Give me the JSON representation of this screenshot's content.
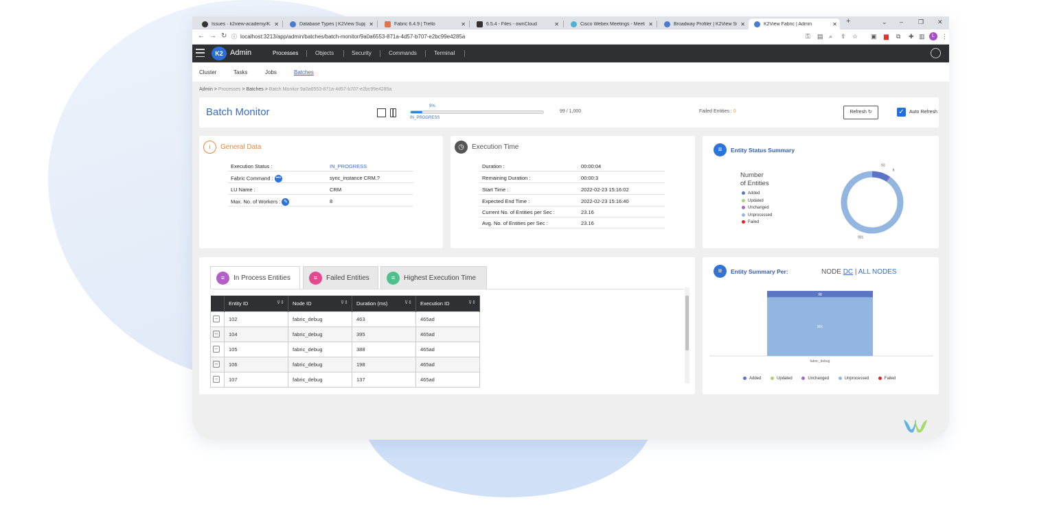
{
  "browser": {
    "tabs": [
      {
        "label": "Issues · k2view-academy/K2View"
      },
      {
        "label": "Database Types | K2View Supp"
      },
      {
        "label": "Fabric 6.4.9 | Trello"
      },
      {
        "label": "6.5.4 - Files - ownCloud"
      },
      {
        "label": "Cisco Webex Meetings - Meetin"
      },
      {
        "label": "Broadway Profiler | K2View Supp"
      },
      {
        "label": "K2View Fabric | Admin"
      }
    ],
    "new_tab": "+",
    "url": "localhost:3213/app/admin/batches/batch-monitor/9a0a6553-871a-4d57-b707-e2bc99e4285a"
  },
  "topnav": {
    "logo": "K2",
    "app": "Admin",
    "items": [
      "Processes",
      "Objects",
      "Security",
      "Commands",
      "Terminal"
    ]
  },
  "subnav": [
    "Cluster",
    "Tasks",
    "Jobs",
    "Batches"
  ],
  "breadcrumb": {
    "items": [
      "Admin",
      "Processes",
      "Batches"
    ],
    "current": "Batch Monitor 9a0a6553-871a-4d57-b707-e2bc99e4285a"
  },
  "header": {
    "title": "Batch Monitor",
    "progress_pct": "9%",
    "progress_fraction": 0.09,
    "progress_count": "99 / 1,000",
    "progress_status": "IN_PROGRESS",
    "failed_label": "Failed Entities :",
    "failed_value": "0",
    "refresh": "Refresh ↻",
    "auto_refresh": "Auto Refresh"
  },
  "general": {
    "title": "General Data",
    "rows": [
      {
        "k": "Execution Status :",
        "v": "IN_PROGRESS"
      },
      {
        "k": "Fabric Command :",
        "v": "sync_instance CRM.?"
      },
      {
        "k": "LU Name :",
        "v": "CRM"
      },
      {
        "k": "Max. No. of Workers :",
        "v": "8"
      }
    ]
  },
  "execution": {
    "title": "Execution Time",
    "rows": [
      {
        "k": "Duration :",
        "v": "00:00:04"
      },
      {
        "k": "Remaining Duration :",
        "v": "00:00:3"
      },
      {
        "k": "Start Time :",
        "v": "2022-02-23 15:16:02"
      },
      {
        "k": "Expected End Time :",
        "v": "2022-02-23 15:16:40"
      },
      {
        "k": "Current No. of Entities per Sec :",
        "v": "23.16"
      },
      {
        "k": "Avg. No. of Entities per Sec :",
        "v": "23.16"
      }
    ]
  },
  "status_summary": {
    "title": "Entity Status Summary",
    "chart_title_1": "Number",
    "chart_title_2": "of Entities",
    "legend": [
      {
        "label": "Added",
        "color": "#5b74c4"
      },
      {
        "label": "Updated",
        "color": "#a6d37a"
      },
      {
        "label": "Unchanged",
        "color": "#a566c8"
      },
      {
        "label": "Unprocessed",
        "color": "#93b6e0"
      },
      {
        "label": "Failed",
        "color": "#e02424"
      }
    ]
  },
  "tabs": [
    {
      "label": "In Process Entities",
      "color": "#b25fc7"
    },
    {
      "label": "Failed Entities",
      "color": "#e4488e"
    },
    {
      "label": "Highest Execution Time",
      "color": "#4fc08d"
    }
  ],
  "table": {
    "headers": [
      "Entity ID",
      "Node ID",
      "Duration (ms)",
      "Execution ID"
    ],
    "rows": [
      [
        "102",
        "fabric_debug",
        "463",
        "465ad"
      ],
      [
        "104",
        "fabric_debug",
        "395",
        "465ad"
      ],
      [
        "105",
        "fabric_debug",
        "388",
        "465ad"
      ],
      [
        "106",
        "fabric_debug",
        "198",
        "465ad"
      ],
      [
        "107",
        "fabric_debug",
        "137",
        "465ad"
      ]
    ]
  },
  "summary_per": {
    "title": "Entity Summary Per:",
    "node": "NODE",
    "dc": "DC",
    "sep": "|",
    "all": "ALL NODES",
    "category": "fabric_debug"
  },
  "chart_data": [
    {
      "type": "pie",
      "title": "Number of Entities",
      "labels": [
        "Added",
        "Updated",
        "Unchanged",
        "Unprocessed",
        "Failed"
      ],
      "values": [
        93,
        0,
        6,
        901,
        0
      ],
      "colors": [
        "#5b74c4",
        "#a6d37a",
        "#a566c8",
        "#93b6e0",
        "#e02424"
      ],
      "legend": "left"
    },
    {
      "type": "bar",
      "stacked": true,
      "categories": [
        "fabric_debug"
      ],
      "series": [
        {
          "name": "Added",
          "values": [
            98
          ]
        },
        {
          "name": "Updated",
          "values": [
            0
          ]
        },
        {
          "name": "Unchanged",
          "values": [
            0
          ]
        },
        {
          "name": "Unprocessed",
          "values": [
            901
          ]
        },
        {
          "name": "Failed",
          "values": [
            0
          ]
        }
      ],
      "ylim": [
        0,
        1000
      ],
      "legend": "bottom"
    }
  ]
}
